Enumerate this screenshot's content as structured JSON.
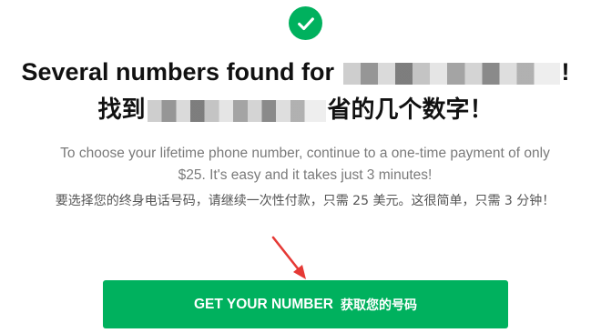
{
  "colors": {
    "accent_green": "#00b15e",
    "check_green": "#00b15e",
    "heading": "#111111",
    "muted_text": "#7a7a7a",
    "arrow_red": "#e53935"
  },
  "icons": {
    "status": "check-circle-icon",
    "annotation": "red-arrow-icon"
  },
  "heading": {
    "en_prefix": "Several numbers found for ",
    "en_suffix": "!",
    "zh_prefix": "找到",
    "zh_suffix": "省的几个数字！"
  },
  "description": {
    "en": "To choose your lifetime phone number, continue to a one-time payment of only $25. It's easy and it takes just 3 minutes!",
    "zh": "要选择您的终身电话号码，请继续一次性付款，只需 25 美元。这很简单，只需 3 分钟！"
  },
  "cta": {
    "label_en": "GET YOUR NUMBER",
    "label_zh": "获取您的号码"
  }
}
